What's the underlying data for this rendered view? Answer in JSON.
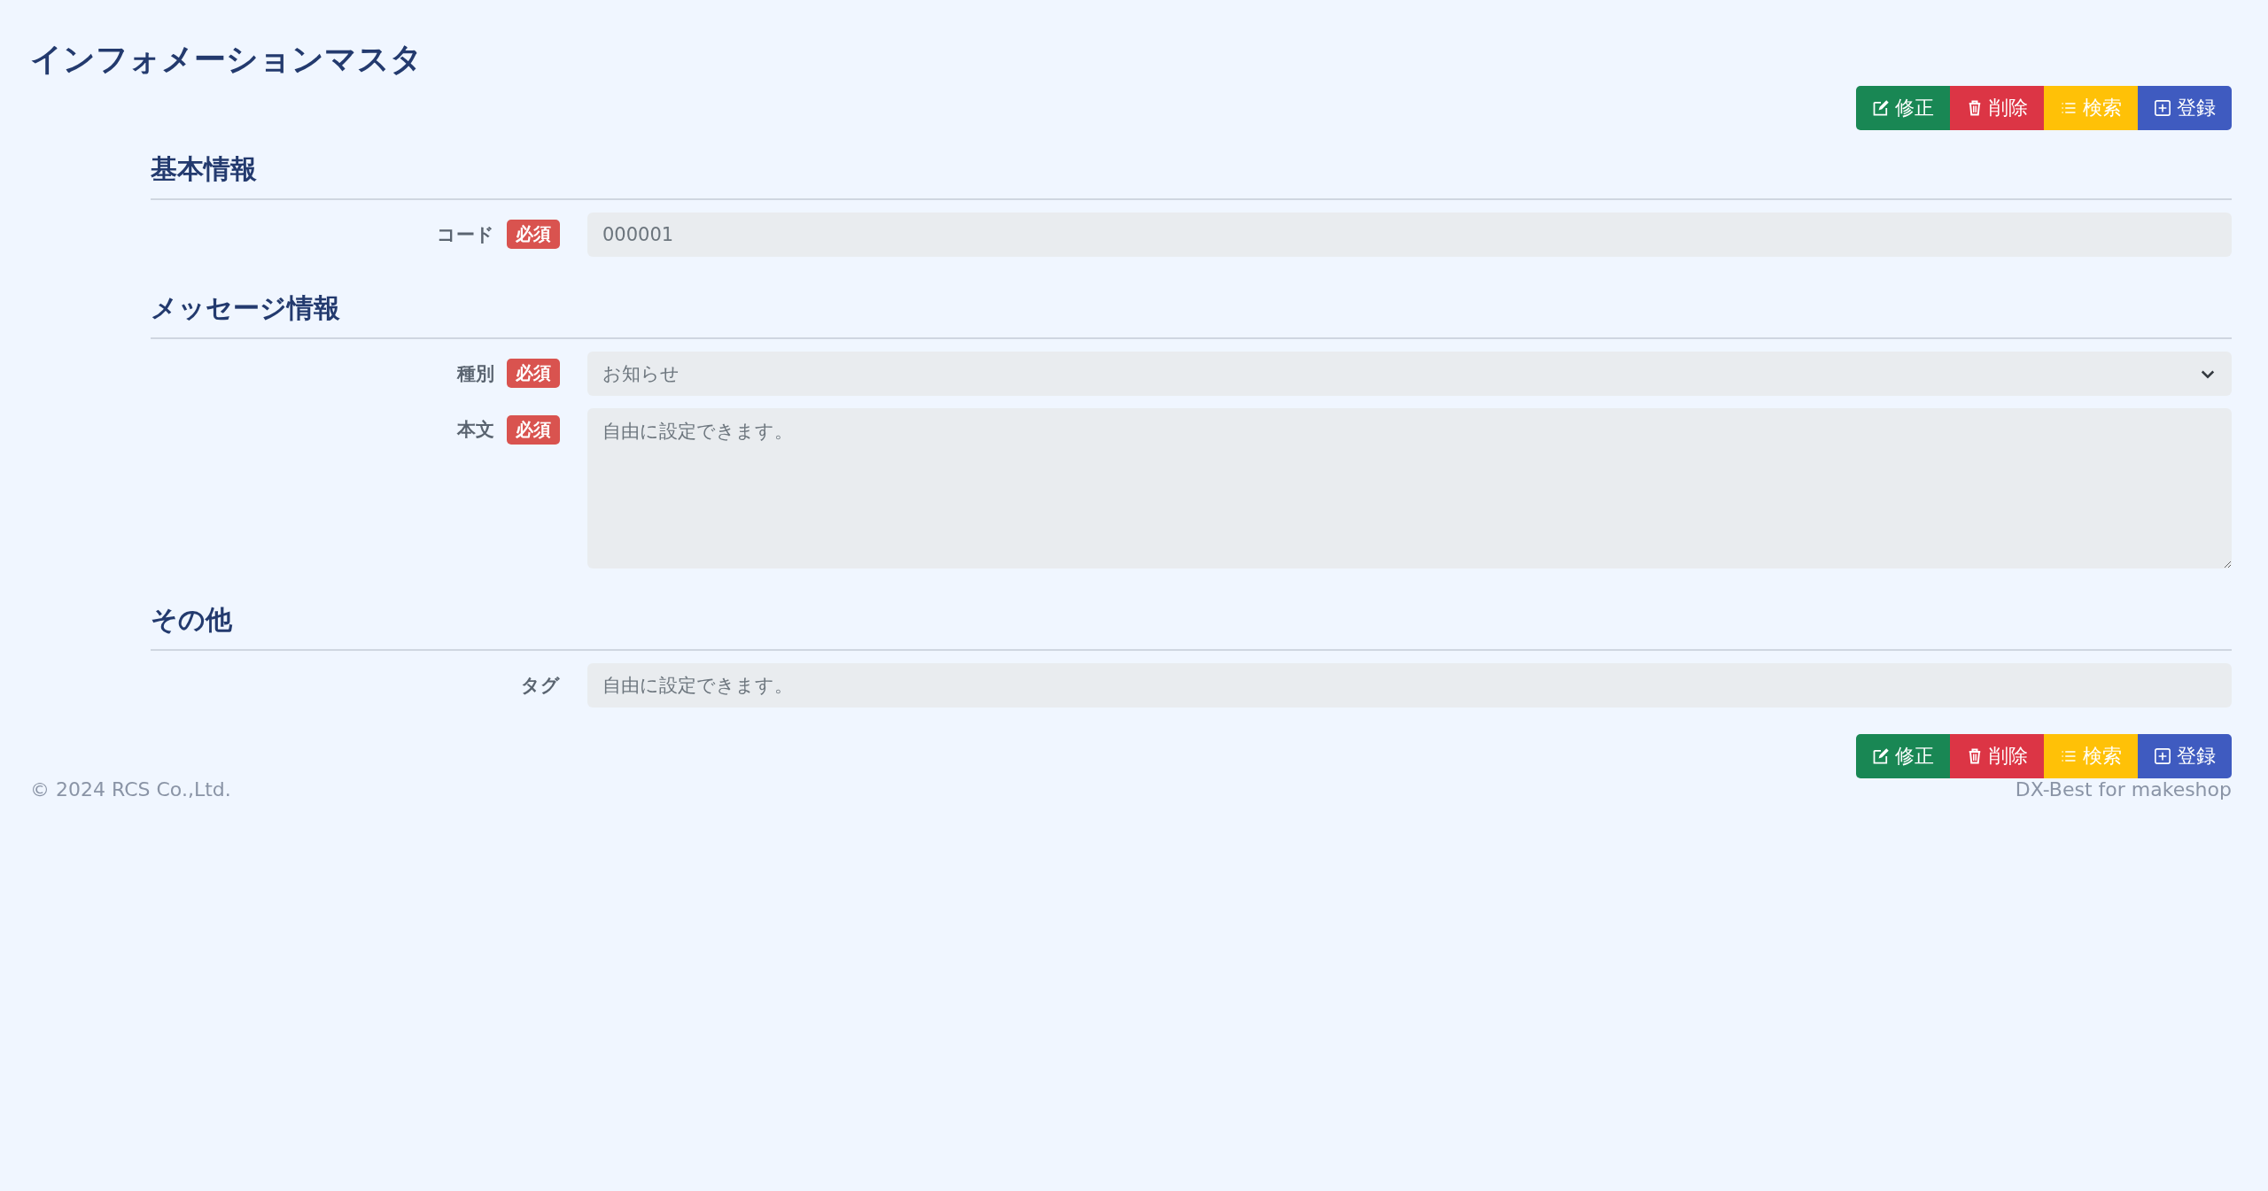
{
  "title": "インフォメーションマスタ",
  "toolbar_top": [
    {
      "label": "修正",
      "kind": "edit"
    },
    {
      "label": "削除",
      "kind": "delete"
    },
    {
      "label": "検索",
      "kind": "search"
    },
    {
      "label": "登録",
      "kind": "register"
    }
  ],
  "sections": [
    {
      "heading": "基本情報",
      "fields": [
        {
          "label": "コード",
          "badge": "必須",
          "kind": "text",
          "value": "000001"
        }
      ]
    },
    {
      "heading": "メッセージ情報",
      "fields": [
        {
          "label": "種別",
          "badge": "必須",
          "kind": "select",
          "value": "お知らせ"
        },
        {
          "label": "本文",
          "badge": "必須",
          "kind": "textarea",
          "placeholder": "自由に設定できます。"
        }
      ]
    },
    {
      "heading": "その他",
      "fields": [
        {
          "label": "タグ",
          "kind": "text",
          "placeholder": "自由に設定できます。"
        }
      ]
    }
  ],
  "toolbar_bottom": [
    {
      "label": "修正",
      "kind": "edit"
    },
    {
      "label": "削除",
      "kind": "delete"
    },
    {
      "label": "検索",
      "kind": "search"
    },
    {
      "label": "登録",
      "kind": "register"
    }
  ],
  "footer": {
    "copyright": "© 2024 RCS Co.,Ltd.",
    "product": "DX-Best for makeshop"
  }
}
